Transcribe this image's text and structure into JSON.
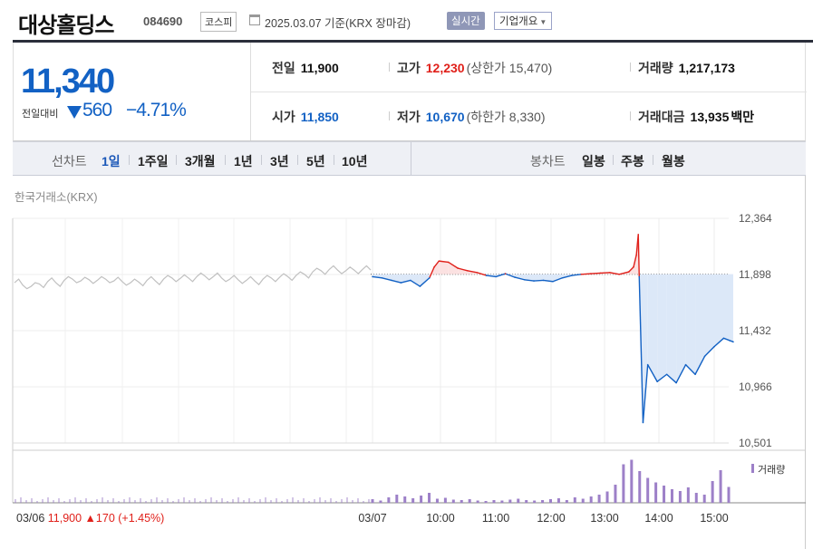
{
  "header": {
    "stock_name": "대상홀딩스",
    "stock_code": "084690",
    "market": "코스피",
    "date_text": "2025.03.07 기준(KRX 장마감)",
    "realtime_label": "실시간",
    "company_info_label": "기업개요",
    "calendar_icon": "calendar-icon",
    "dropdown_icon": "caret-down-icon"
  },
  "summary": {
    "price": "11,340",
    "compare_label": "전일대비",
    "change": "560",
    "change_pct": "−4.71%",
    "direction_icon": "down-triangle-icon",
    "prev_close_label": "전일",
    "prev_close": "11,900",
    "high_label": "고가",
    "high": "12,230",
    "upper_limit": "(상한가 15,470)",
    "volume_label": "거래량",
    "volume": "1,217,173",
    "open_label": "시가",
    "open": "11,850",
    "low_label": "저가",
    "low": "10,670",
    "lower_limit": "(하한가 8,330)",
    "amount_label": "거래대금",
    "amount": "13,935",
    "amount_unit": "백만"
  },
  "periods": {
    "line_chart_label": "선차트",
    "line_options": [
      "1일",
      "1주일",
      "3개월",
      "1년",
      "3년",
      "5년",
      "10년"
    ],
    "selected": "1일",
    "candle_chart_label": "봉차트",
    "candle_options": [
      "일봉",
      "주봉",
      "월봉"
    ]
  },
  "colors": {
    "up": "#e0201a",
    "down": "#1261c4",
    "fill_down": "#dce8f8",
    "fill_up": "#fbe1e1",
    "prev_day": "#c0c0c0",
    "volume": "#9d80c8"
  },
  "chart_data": {
    "type": "line",
    "title": "한국거래소(KRX)",
    "baseline": 11900,
    "ylim": [
      10501,
      12364
    ],
    "y_ticks": [
      "12,364",
      "11,898",
      "11,432",
      "10,966",
      "10,501"
    ],
    "x_ticks": [
      "03/06",
      "03/07",
      "10:00",
      "11:00",
      "12:00",
      "13:00",
      "14:00",
      "15:00"
    ],
    "legend": "거래량",
    "prev_day_footer": {
      "date": "03/06",
      "close": "11,900",
      "arrow": "▲",
      "change": "170",
      "pct": "(+1.45%)"
    },
    "prev_day_series": {
      "name": "03/06",
      "values": [
        11830,
        11810,
        11800,
        11820,
        11840,
        11830,
        11850,
        11860,
        11845,
        11855,
        11850,
        11860,
        11845,
        11840,
        11830,
        11835,
        11850,
        11845,
        11860,
        11870,
        11865,
        11870,
        11880,
        11885,
        11880,
        11870,
        11860,
        11855,
        11850,
        11845,
        11860,
        11870,
        11875,
        11880,
        11890,
        11900,
        11920,
        11930,
        11940,
        11935,
        11930,
        11935,
        11940,
        11935
      ]
    },
    "today_series": {
      "name": "03/07",
      "times": [
        "09:00",
        "09:10",
        "09:20",
        "09:30",
        "09:40",
        "09:50",
        "10:00",
        "10:05",
        "10:10",
        "10:20",
        "10:30",
        "10:40",
        "10:50",
        "11:00",
        "11:10",
        "11:20",
        "11:30",
        "11:40",
        "11:50",
        "12:00",
        "12:10",
        "12:20",
        "12:30",
        "12:40",
        "12:50",
        "13:00",
        "13:10",
        "13:20",
        "13:30",
        "13:35",
        "13:38",
        "13:40",
        "13:41",
        "13:45",
        "13:50",
        "14:00",
        "14:10",
        "14:20",
        "14:30",
        "14:40",
        "14:50",
        "15:00",
        "15:10",
        "15:20"
      ],
      "values": [
        11880,
        11870,
        11850,
        11830,
        11850,
        11800,
        11870,
        11960,
        12010,
        12000,
        11950,
        11930,
        11915,
        11890,
        11880,
        11905,
        11875,
        11855,
        11845,
        11850,
        11840,
        11870,
        11890,
        11900,
        11905,
        11910,
        11915,
        11900,
        11920,
        11960,
        12060,
        12230,
        11880,
        10670,
        11150,
        11010,
        11070,
        11000,
        11150,
        11070,
        11220,
        11300,
        11370,
        11340
      ]
    },
    "volume_ylim": [
      0,
      100
    ],
    "volume_bars": [
      8,
      5,
      12,
      18,
      14,
      10,
      16,
      22,
      9,
      11,
      7,
      6,
      8,
      5,
      4,
      6,
      5,
      7,
      9,
      6,
      5,
      6,
      8,
      10,
      6,
      12,
      9,
      14,
      18,
      25,
      40,
      85,
      95,
      70,
      55,
      45,
      38,
      30,
      26,
      34,
      22,
      18,
      48,
      72,
      35
    ]
  }
}
